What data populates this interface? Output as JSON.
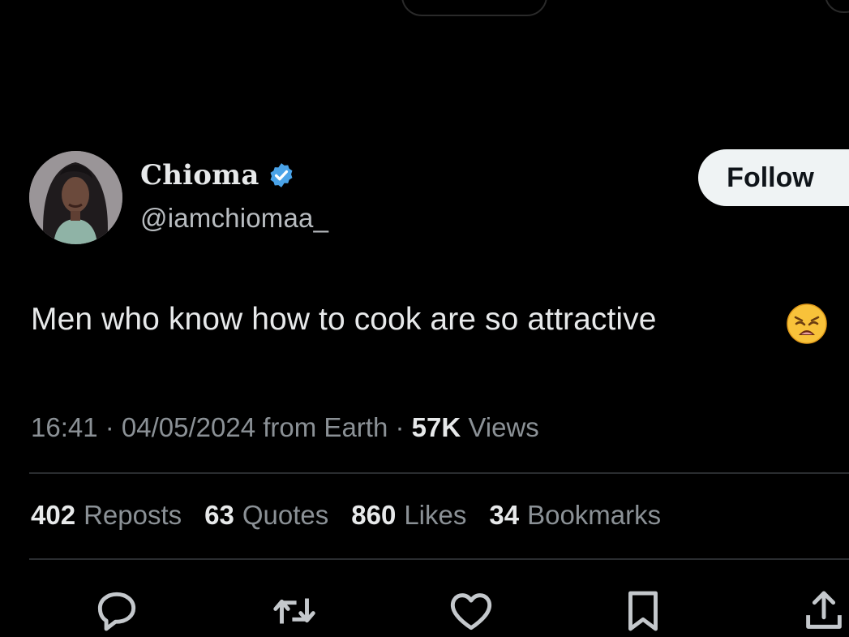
{
  "author": {
    "display_name": "Chioma",
    "handle": "@iamchiomaa_",
    "verified": true
  },
  "follow_label": "Follow",
  "tweet": {
    "text": "Men who know how to cook are so attractive",
    "emoji": "weary-face"
  },
  "meta": {
    "time": "16:41",
    "sep1": " · ",
    "date": "04/05/2024",
    "location": " from Earth",
    "sep2": " · ",
    "views_count": "57K",
    "views_label": " Views"
  },
  "stats": {
    "reposts": {
      "count": "402",
      "label": "Reposts"
    },
    "quotes": {
      "count": "63",
      "label": "Quotes"
    },
    "likes": {
      "count": "860",
      "label": "Likes"
    },
    "bookmarks": {
      "count": "34",
      "label": "Bookmarks"
    }
  },
  "actions": [
    "reply-icon",
    "repost-icon",
    "like-icon",
    "bookmark-icon",
    "share-icon"
  ],
  "colors": {
    "background": "#000000",
    "text": "#e7e9ea",
    "muted": "#8b9196",
    "verified": "#4aa3e8",
    "follow_bg": "#eff3f4"
  }
}
